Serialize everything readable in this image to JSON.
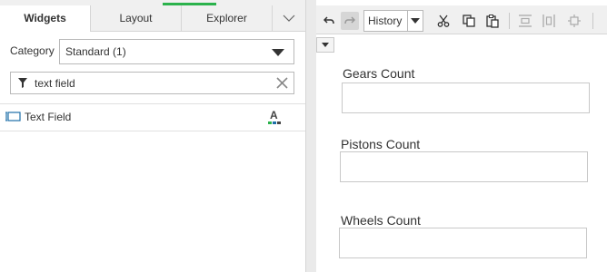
{
  "tabs": [
    {
      "label": "Widgets",
      "active": true
    },
    {
      "label": "Layout",
      "active": false
    },
    {
      "label": "Explorer",
      "active": false
    }
  ],
  "category": {
    "label": "Category",
    "selected": "Standard (1)"
  },
  "search": {
    "value": "text field"
  },
  "widgets": [
    {
      "label": "Text Field",
      "icon": "text-field-icon"
    }
  ],
  "toolbar": {
    "history_label": "History",
    "icons": [
      "undo-icon",
      "redo-icon",
      "cut-icon",
      "copy-icon",
      "paste-icon",
      "distribute-vertical-icon",
      "distribute-horizontal-icon",
      "center-icon"
    ]
  },
  "canvas": {
    "fields": [
      {
        "label": "Gears Count",
        "value": ""
      },
      {
        "label": "Pistons Count",
        "value": ""
      },
      {
        "label": "Wheels Count",
        "value": ""
      }
    ]
  },
  "colors": {
    "accent": "#2bb24c",
    "icon_blue": "#1d6fa8"
  }
}
